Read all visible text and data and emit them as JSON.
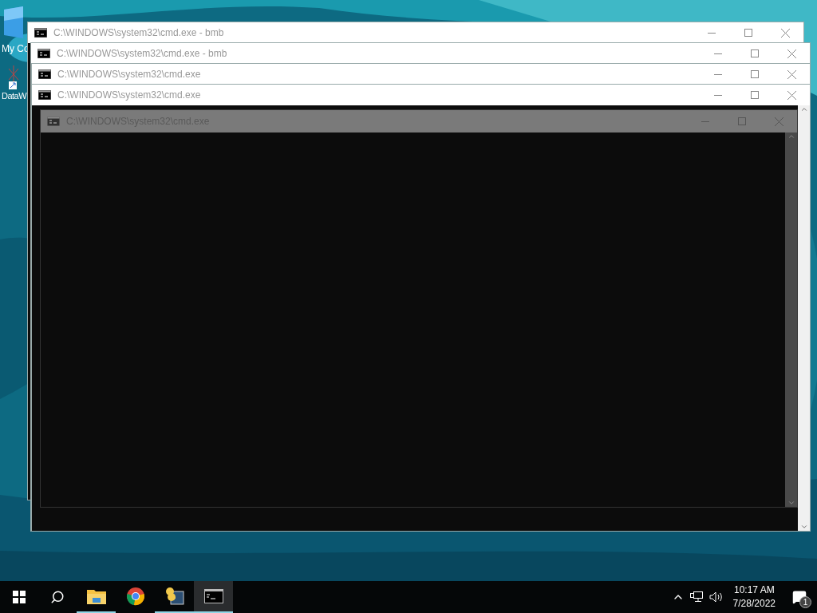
{
  "desktop_icons": [
    {
      "label": "My Co"
    },
    {
      "label": "DataW"
    }
  ],
  "windows": [
    {
      "title": "C:\\WINDOWS\\system32\\cmd.exe - bmb",
      "kind": "normal"
    },
    {
      "title": "C:\\WINDOWS\\system32\\cmd.exe - bmb",
      "kind": "normal"
    },
    {
      "title": "C:\\WINDOWS\\system32\\cmd.exe",
      "kind": "normal"
    },
    {
      "title": "C:\\WINDOWS\\system32\\cmd.exe",
      "kind": "normal"
    },
    {
      "title": "C:\\WINDOWS\\system32\\cmd.exe",
      "kind": "ghost"
    }
  ],
  "taskbar": {
    "apps": [
      {
        "kind": "explorer",
        "running": true,
        "selected": false
      },
      {
        "kind": "chrome",
        "running": false,
        "selected": false
      },
      {
        "kind": "python",
        "running": true,
        "selected": false
      },
      {
        "kind": "console",
        "running": true,
        "selected": true
      }
    ],
    "time": "10:17 AM",
    "date": "7/28/2022",
    "notifications": "1"
  }
}
